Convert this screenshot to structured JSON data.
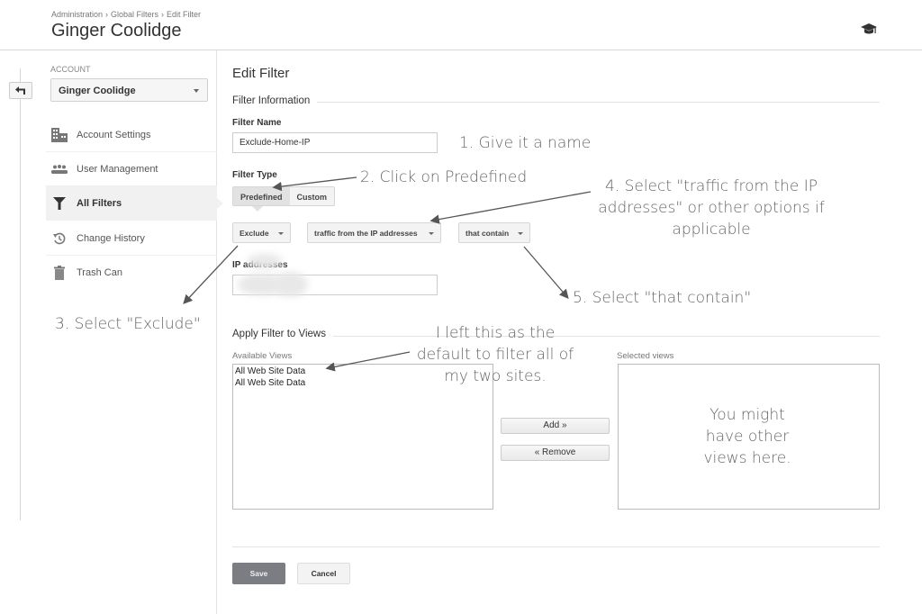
{
  "header": {
    "breadcrumb": [
      "Administration",
      "Global Filters",
      "Edit Filter"
    ],
    "breadcrumb_sep": "›",
    "title": "Ginger Coolidge",
    "help_icon": "graduation-cap-icon"
  },
  "sidebar": {
    "back_icon": "back-arrow-icon",
    "account_label": "ACCOUNT",
    "account_value": "Ginger Coolidge",
    "items": [
      {
        "label": "Account Settings",
        "icon": "building-icon",
        "active": false
      },
      {
        "label": "User Management",
        "icon": "users-icon",
        "active": false
      },
      {
        "label": "All Filters",
        "icon": "filter-icon",
        "active": true
      },
      {
        "label": "Change History",
        "icon": "history-icon",
        "active": false
      },
      {
        "label": "Trash Can",
        "icon": "trash-icon",
        "active": false
      }
    ]
  },
  "main": {
    "title": "Edit Filter",
    "filter_info_label": "Filter Information",
    "filter_name_label": "Filter Name",
    "filter_name_value": "Exclude-Home-IP",
    "filter_type_label": "Filter Type",
    "filter_type_tabs": [
      "Predefined",
      "Custom"
    ],
    "filter_type_selected": "Predefined",
    "dropdowns": {
      "action": "Exclude",
      "source": "traffic from the IP addresses",
      "operator": "that contain"
    },
    "ip_label": "IP addresses",
    "ip_value": "",
    "apply_label": "Apply Filter to Views",
    "available_views_label": "Available Views",
    "available_views": [
      "All Web Site Data",
      "All Web Site Data"
    ],
    "selected_views_label": "Selected views",
    "selected_views": [],
    "add_button": "Add »",
    "remove_button": "« Remove",
    "save_button": "Save",
    "cancel_button": "Cancel"
  },
  "annotations": {
    "step1": "1. Give it a name",
    "step2": "2. Click on Predefined",
    "step3": "3. Select \"Exclude\"",
    "step4_line1": "4. Select \"traffic from the IP",
    "step4_line2": "addresses\" or other options if",
    "step4_line3": "applicable",
    "step5": "5. Select \"that contain\"",
    "note_line1": "I left this as the",
    "note_line2": "default to filter all of",
    "note_line3": "my two sites.",
    "views_line1": "You might",
    "views_line2": "have other",
    "views_line3": "views here."
  }
}
